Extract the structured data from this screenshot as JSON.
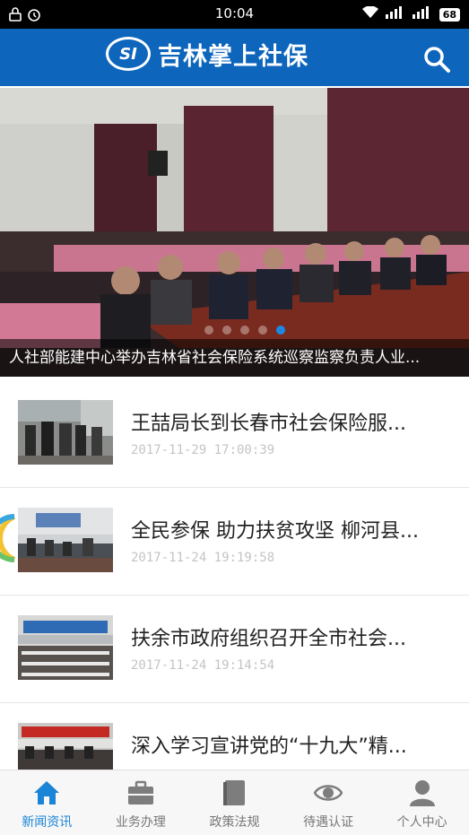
{
  "status_bar": {
    "time": "10:04",
    "battery": "68"
  },
  "header": {
    "app_name": "吉林掌上社保",
    "logo_mark": "SI"
  },
  "banner": {
    "caption": "人社部能建中心举办吉林省社会保险系统巡察监察负责人业...",
    "active_dot": 4,
    "dot_count": 5
  },
  "news": [
    {
      "title": "王喆局长到长春市社会保险服...",
      "time": "2017-11-29 17:00:39"
    },
    {
      "title": "全民参保 助力扶贫攻坚 柳河县...",
      "time": "2017-11-24 19:19:58"
    },
    {
      "title": "扶余市政府组织召开全市社会...",
      "time": "2017-11-24 19:14:54"
    },
    {
      "title": "深入学习宣讲党的“十九大”精...",
      "time": ""
    }
  ],
  "nav": [
    {
      "label": "新闻资讯",
      "icon": "home-icon",
      "active": true
    },
    {
      "label": "业务办理",
      "icon": "briefcase-icon",
      "active": false
    },
    {
      "label": "政策法规",
      "icon": "book-icon",
      "active": false
    },
    {
      "label": "待遇认证",
      "icon": "eye-icon",
      "active": false
    },
    {
      "label": "个人中心",
      "icon": "person-icon",
      "active": false
    }
  ],
  "colors": {
    "header_blue": "#0d65bc",
    "active_blue": "#1a84d6",
    "time_gray": "#c4c4c4"
  }
}
